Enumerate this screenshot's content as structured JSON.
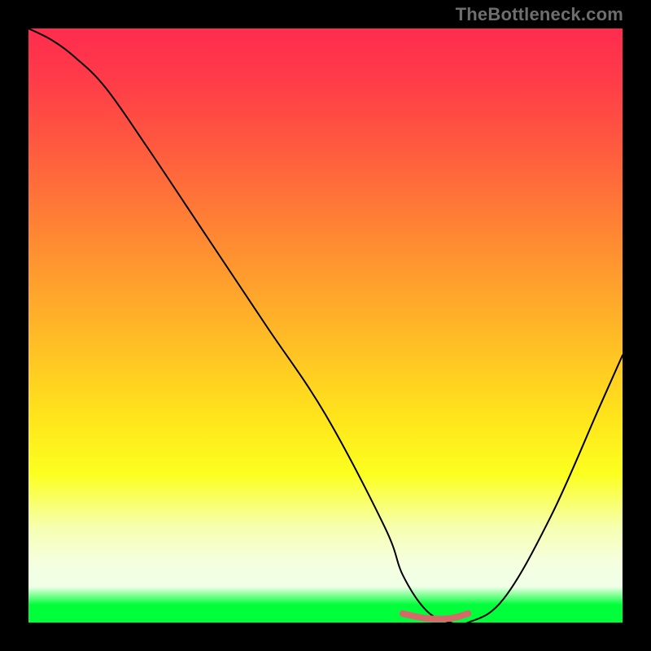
{
  "watermark": "TheBottleneck.com",
  "colors": {
    "background": "#000000",
    "curve": "#000000",
    "bottom_marker": "#d46a6a"
  },
  "chart_data": {
    "type": "line",
    "title": "",
    "xlabel": "",
    "ylabel": "",
    "xlim": [
      0,
      100
    ],
    "ylim": [
      0,
      100
    ],
    "series": [
      {
        "name": "bottleneck-curve",
        "x": [
          0,
          4,
          8,
          13,
          20,
          30,
          40,
          50,
          60,
          63,
          67,
          71,
          74,
          80,
          88,
          96,
          100
        ],
        "y": [
          100,
          98,
          95,
          90,
          80,
          65,
          50,
          35,
          16,
          8,
          2,
          0,
          0,
          4,
          18,
          36,
          45
        ]
      },
      {
        "name": "optimal-range-marker",
        "x": [
          63,
          67,
          71,
          74
        ],
        "y": [
          1.5,
          0.7,
          0.7,
          1.5
        ]
      }
    ],
    "annotations": [
      {
        "text": "TheBottleneck.com",
        "role": "watermark",
        "position": "top-right"
      }
    ]
  }
}
